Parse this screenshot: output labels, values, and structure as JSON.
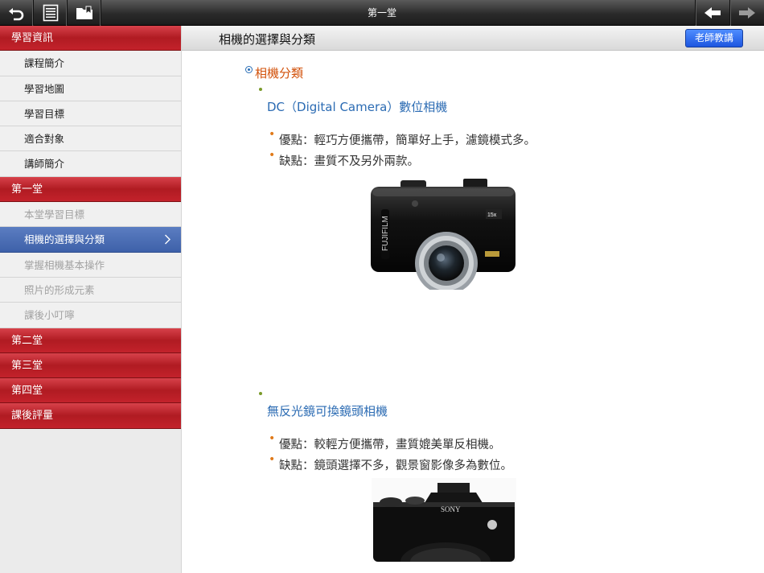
{
  "topbar": {
    "title": "第一堂",
    "icons": [
      "back-undo-icon",
      "list-icon",
      "bookmark-folder-icon",
      "prev-arrow-icon",
      "next-arrow-icon"
    ]
  },
  "sidebar": {
    "groups": [
      {
        "label": "學習資訊",
        "items": [
          "課程簡介",
          "學習地圖",
          "學習目標",
          "適合對象",
          "講師簡介"
        ]
      },
      {
        "label": "第一堂",
        "items": [
          "本堂學習目標",
          "相機的選擇與分類",
          "掌握相機基本操作",
          "照片的形成元素",
          "課後小叮嚀"
        ]
      },
      {
        "label": "第二堂"
      },
      {
        "label": "第三堂"
      },
      {
        "label": "第四堂"
      },
      {
        "label": "課後評量"
      }
    ],
    "active_item": "相機的選擇與分類"
  },
  "header": {
    "title": "相機的選擇與分類",
    "teacher_button": "老師教講"
  },
  "content": {
    "heading": "相機分類",
    "sections": [
      {
        "title": "DC（Digital Camera）數位相機",
        "pros": "優點：輕巧方便攜帶，簡單好上手，濾鏡模式多。",
        "cons": "缺點：畫質不及另外兩款。",
        "image_brand": "FUJIFILM",
        "image_zoom": "15x"
      },
      {
        "title": "無反光鏡可換鏡頭相機",
        "pros": "優點：較輕方便攜帶，畫質媲美單反相機。",
        "cons": "缺點：鏡頭選擇不多，觀景窗影像多為數位。",
        "image_brand": "SONY"
      }
    ]
  },
  "colors": {
    "section_red": "#c3222b",
    "active_blue": "#3e61a9",
    "heading_orange": "#d2510a",
    "subheading_blue": "#2b6bb3",
    "button_blue": "#1d56e0"
  }
}
